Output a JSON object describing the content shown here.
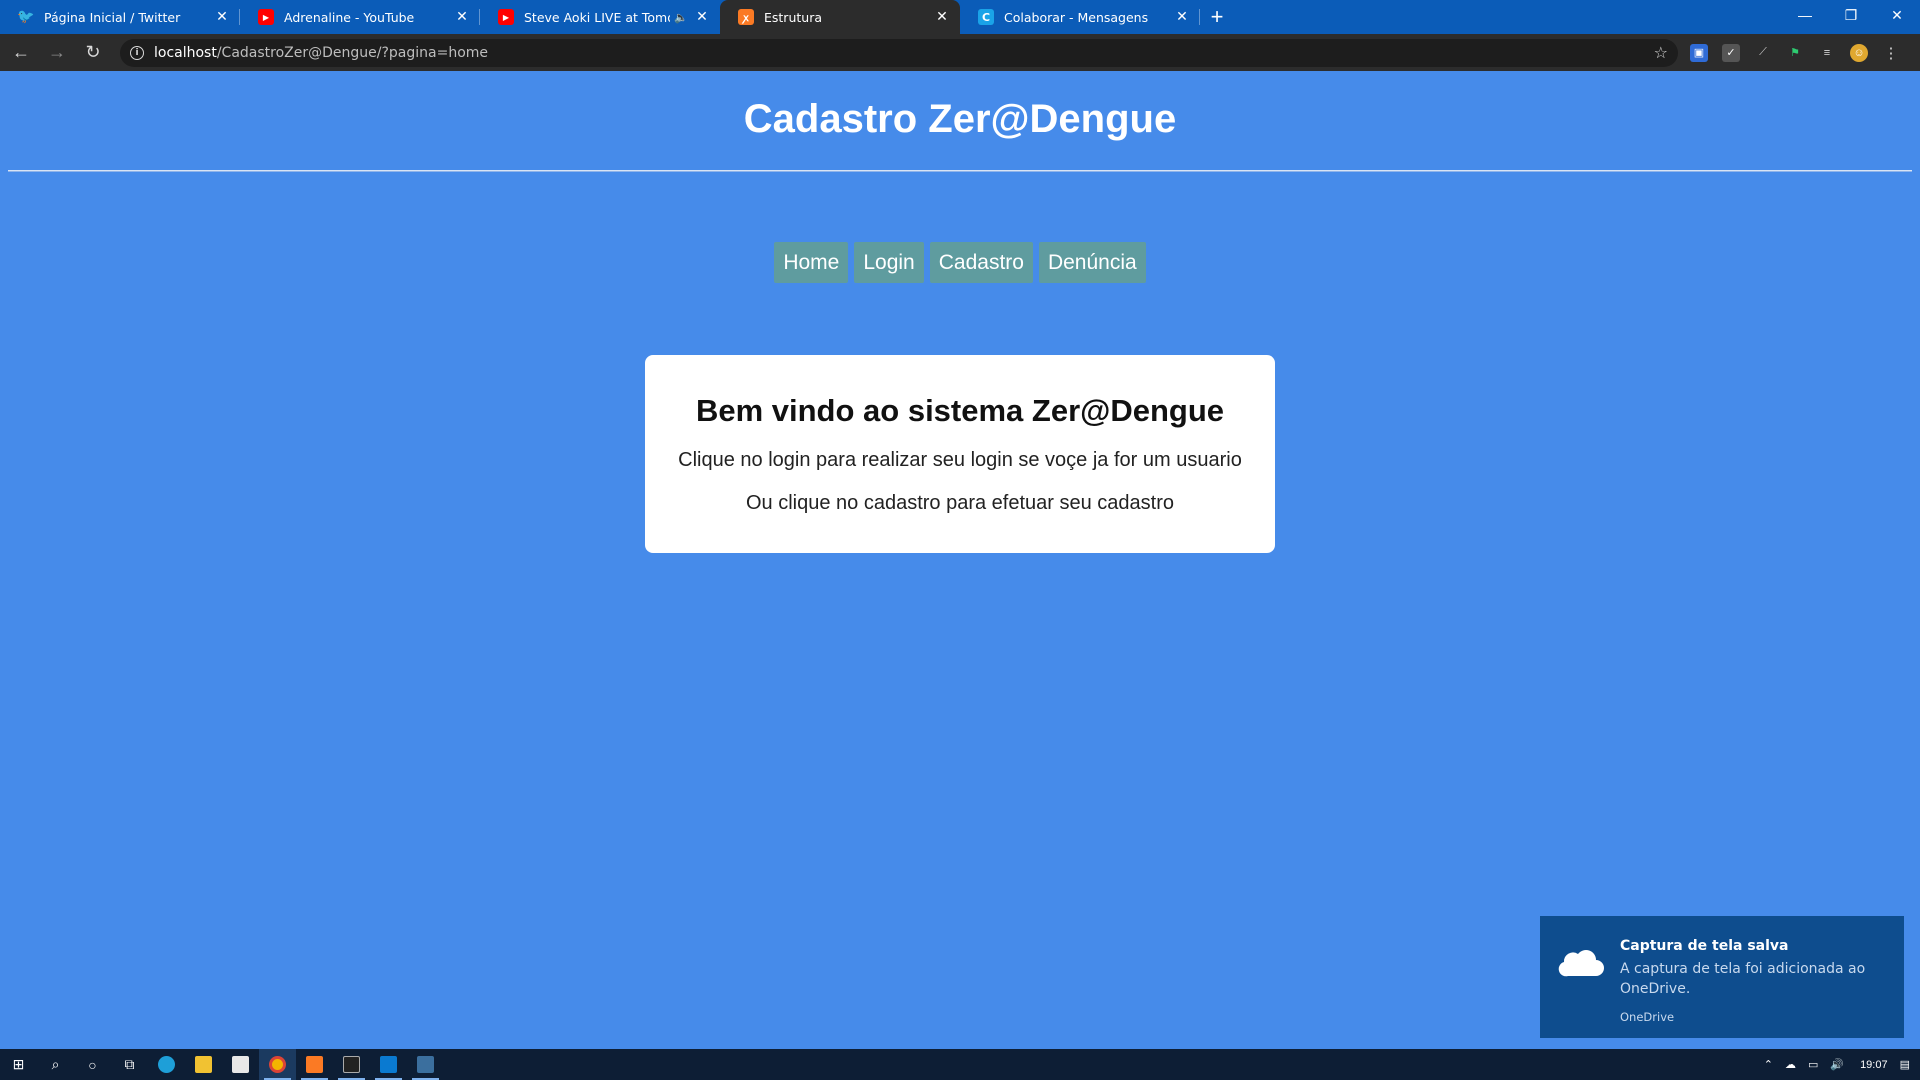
{
  "browser": {
    "tabs": [
      {
        "title": "Página Inicial / Twitter",
        "icon": "twitter-icon",
        "color": "#1d9bf0",
        "active": false
      },
      {
        "title": "Adrenaline - YouTube",
        "icon": "youtube-icon",
        "color": "#ff0000",
        "active": false
      },
      {
        "title": "Steve Aoki LIVE at Tomorrowland",
        "icon": "youtube-icon",
        "color": "#ff0000",
        "active": false,
        "audio": true
      },
      {
        "title": "Estrutura",
        "icon": "xampp-icon",
        "color": "#fb7a24",
        "active": true
      },
      {
        "title": "Colaborar - Mensagens",
        "icon": "colaborar-icon",
        "color": "#1aa3e8",
        "active": false
      }
    ],
    "new_tab_label": "+",
    "url_host": "localhost",
    "url_path": "/CadastroZer@Dengue/?pagina=home"
  },
  "page": {
    "title": "Cadastro Zer@Dengue",
    "menu": [
      "Home",
      "Login",
      "Cadastro",
      "Denúncia"
    ],
    "card": {
      "heading": "Bem vindo ao sistema Zer@Dengue",
      "line1": "Clique no login para realizar seu login se voçe ja for um usuario",
      "line2": "Ou clique no cadastro para efetuar seu cadastro"
    }
  },
  "toast": {
    "title": "Captura de tela salva",
    "message": "A captura de tela foi adicionada ao OneDrive.",
    "app": "OneDrive"
  },
  "taskbar": {
    "clock": "19:07"
  },
  "colors": {
    "page_background": "#468bea",
    "menu_button": "#5f9c9f",
    "tabstrip": "#0b5cb8",
    "toast": "#0e4d8e"
  }
}
